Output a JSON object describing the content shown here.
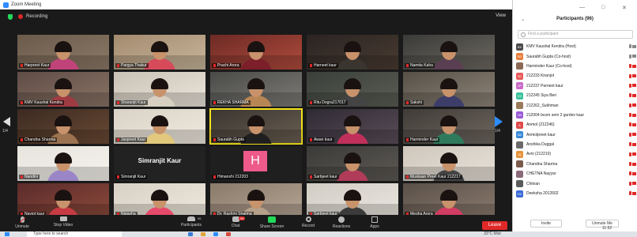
{
  "window": {
    "title": "Zoom Meeting"
  },
  "topbar": {
    "recording_label": "Recording",
    "view_label": "View"
  },
  "pager": {
    "left": "1/4",
    "right": "1/4"
  },
  "tiles": [
    {
      "name": "Harpreet Kaur",
      "a": "#6b5a4a",
      "b": "#8c7a68",
      "c": "#c0447a",
      "type": "person"
    },
    {
      "name": "Pargya Thakur",
      "a": "#a38a6e",
      "b": "#c9b79c",
      "c": "#d64a5a",
      "type": "person"
    },
    {
      "name": "Prachi Arora",
      "a": "#6c2a25",
      "b": "#b24c3c",
      "c": "#7d1f2a",
      "type": "person"
    },
    {
      "name": "Harneet kaur",
      "a": "#2a2422",
      "b": "#4a3c32",
      "c": "#3b3530",
      "type": "person"
    },
    {
      "name": "Namita Kalra",
      "a": "#3a3a38",
      "b": "#6e6a62",
      "c": "#5a3e52",
      "type": "person"
    },
    {
      "name": "KMV Kaushal Kendra",
      "a": "#5f4c46",
      "b": "#8a7466",
      "c": "#9f3b42",
      "type": "person"
    },
    {
      "name": "Sharanjit Kaur",
      "a": "#c9c1b5",
      "b": "#ece6db",
      "c": "#d7d0c2",
      "type": "person"
    },
    {
      "name": "REKHA SHARMA",
      "a": "#4a4a48",
      "b": "#7d7c78",
      "c": "#b88654",
      "type": "person"
    },
    {
      "name": "Ritu Dogra217017",
      "a": "#3b3f3a",
      "b": "#5a5e55",
      "c": "#444",
      "type": "person"
    },
    {
      "name": "Sakshi",
      "a": "#565046",
      "b": "#8f857a",
      "c": "#3d3d6a",
      "type": "person"
    },
    {
      "name": "Chandna Sharma",
      "a": "#3b2a22",
      "b": "#6b4a33",
      "c": "#9c7350",
      "type": "person"
    },
    {
      "name": "Jaspreet Kaur",
      "a": "#d9d3c7",
      "b": "#efe9de",
      "c": "#e2c87d",
      "type": "person"
    },
    {
      "name": "Saurabh Gupta",
      "a": "#3a3530",
      "b": "#6a5f52",
      "c": "#1f1f1f",
      "type": "person",
      "speaking": true
    },
    {
      "name": "Awan kaur",
      "a": "#2e2a33",
      "b": "#5b4e59",
      "c": "#c1305a",
      "type": "person"
    },
    {
      "name": "Harminder Kaur",
      "a": "#3f3b36",
      "b": "#6f6860",
      "c": "#2f7a5d",
      "type": "person"
    },
    {
      "name": "Nandini",
      "a": "#e7e4de",
      "b": "#f5f2ec",
      "c": "#9a86c7",
      "type": "person"
    },
    {
      "name": "Simranjit Kaur",
      "type": "text",
      "big": "Simranjit Kaur"
    },
    {
      "name": "Himanshi 212203",
      "type": "h",
      "letter": "H"
    },
    {
      "name": "Sarbjeet kaur",
      "a": "#3a3a38",
      "b": "#5e5a55",
      "c": "#b03c5a",
      "type": "person"
    },
    {
      "name": "Muskaan Preet Kaur 212217",
      "a": "#cfc7bc",
      "b": "#e7e1d8",
      "c": "#444",
      "type": "person"
    },
    {
      "name": "Navjot kaur",
      "a": "#5b2b2b",
      "b": "#8c4a3a",
      "c": "#c63b43",
      "type": "person"
    },
    {
      "name": "Natasha",
      "a": "#d7d1c5",
      "b": "#efe9dd",
      "c": "#e64a6a",
      "type": "person"
    },
    {
      "name": "Dr. Rashmi Sharma",
      "a": "#8a7a6a",
      "b": "#b5a595",
      "c": "#b7a08a",
      "type": "person"
    },
    {
      "name": "Sarbjeet kaur",
      "a": "#d1ccc4",
      "b": "#eae6df",
      "c": "#3b3b3b",
      "type": "person"
    },
    {
      "name": "Megha Arora",
      "a": "#5a5048",
      "b": "#8a7a6e",
      "c": "#d13c62",
      "type": "person"
    }
  ],
  "controls": {
    "unmute": "Unmute",
    "stop_video": "Stop Video",
    "participants": "Participants",
    "participants_count": "96",
    "chat": "Chat",
    "chat_badge": "99",
    "share": "Share Screen",
    "record": "Record",
    "reactions": "Reactions",
    "apps": "Apps",
    "leave": "Leave"
  },
  "taskbar": {
    "search_placeholder": "Type here to search",
    "system_text": "33°C Mist",
    "time": "11:52"
  },
  "panel": {
    "title": "Participants (96)",
    "search_placeholder": "Find a participant",
    "participants": [
      {
        "initials": "KK",
        "name": "KMV Kaushal Kendra (Host)",
        "color": "#4a4a4a",
        "muted": false
      },
      {
        "initials": "SG",
        "name": "Saurabh Gupta (Co-host)",
        "color": "#e87e3c",
        "muted": false
      },
      {
        "initials": "",
        "name": "Harminder Kaur (Co-host)",
        "color": "#8b6a55",
        "muted": true
      },
      {
        "initials": "2K",
        "name": "212233 Kiranjot",
        "color": "#e85a5a",
        "muted": true
      },
      {
        "initials": "2P",
        "name": "212237 Parneet kaur",
        "color": "#c86ac8",
        "muted": true
      },
      {
        "initials": "2S",
        "name": "212245 Siya Beri",
        "color": "#3cc29a",
        "muted": true
      },
      {
        "initials": "",
        "name": "212262_Sukhman",
        "color": "#9a7a5a",
        "muted": true
      },
      {
        "initials": "2B",
        "name": "212004 bcom sem 2 gurdev kaur",
        "color": "#9a5ad8",
        "muted": true
      },
      {
        "initials": "A",
        "name": "Anmol (212246)",
        "color": "#e04a4a",
        "muted": true
      },
      {
        "initials": "AK",
        "name": "Anmolpreet kaur",
        "color": "#3a8ad8",
        "muted": true
      },
      {
        "initials": "",
        "name": "Anshika Duggal",
        "color": "#6a6a6a",
        "muted": true
      },
      {
        "initials": "A(",
        "name": "Avni (212210)",
        "color": "#e8923a",
        "muted": true
      },
      {
        "initials": "",
        "name": "Chandna Sharma",
        "color": "#7a5a4a",
        "muted": true
      },
      {
        "initials": "",
        "name": "CHETNA Nayyar",
        "color": "#8a6a7a",
        "muted": true
      },
      {
        "initials": "",
        "name": "Chitvan",
        "color": "#5a5a5a",
        "muted": true
      },
      {
        "initials": "D2",
        "name": "Deeksha 2012602",
        "color": "#3a6ad8",
        "muted": true
      }
    ],
    "invite_label": "Invite",
    "unmute_me_label": "Unmute Me"
  }
}
